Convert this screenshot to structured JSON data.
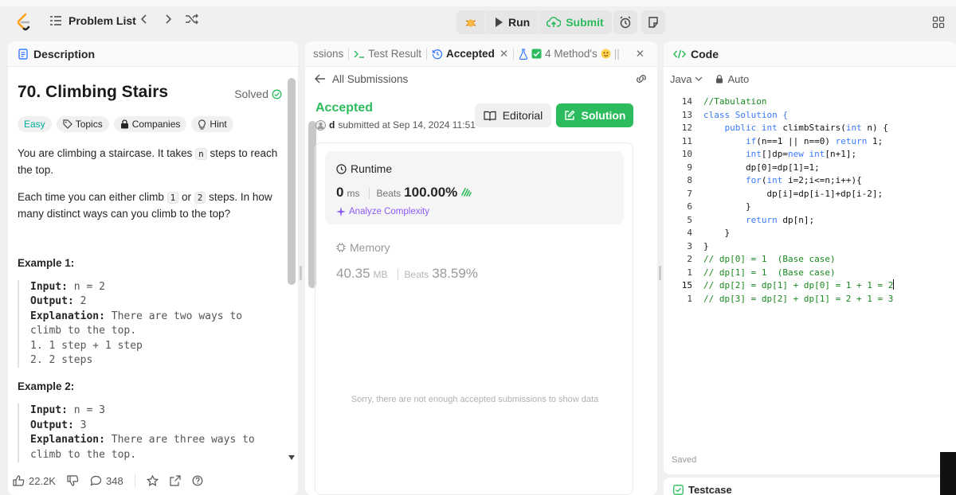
{
  "topbar": {
    "problem_list": "Problem List",
    "run": "Run",
    "submit": "Submit"
  },
  "colors": {
    "accent_green": "#2cbb5d",
    "easy": "#00af9b",
    "orange": "#ffa116",
    "purple": "#8b5cf6",
    "keyword_blue": "#3a7bff",
    "comment_green": "#18891e"
  },
  "description": {
    "tab_label": "Description",
    "title": "70. Climbing Stairs",
    "solved": "Solved",
    "tags": {
      "easy": "Easy",
      "topics": "Topics",
      "companies": "Companies",
      "hint": "Hint"
    },
    "para1": {
      "before": "You are climbing a staircase. It takes ",
      "code": "n",
      "after": " steps to reach the top."
    },
    "para2": {
      "a": "Each time you can either climb ",
      "c1": "1",
      "b": " or ",
      "c2": "2",
      "d": " steps. In how many distinct ways can you climb to the top?"
    },
    "examples": [
      {
        "title": "Example 1:",
        "input_label": "Input:",
        "input_value": " n = 2",
        "output_label": "Output:",
        "output_value": " 2",
        "explanation_label": "Explanation:",
        "explanation_value": " There are two ways to\nclimb to the top.\n1. 1 step + 1 step\n2. 2 steps"
      },
      {
        "title": "Example 2:",
        "input_label": "Input:",
        "input_value": " n = 3",
        "output_label": "Output:",
        "output_value": " 3",
        "explanation_label": "Explanation:",
        "explanation_value": " There are three ways to\nclimb to the top."
      }
    ],
    "footer": {
      "likes": "22.2K",
      "comments": "348"
    }
  },
  "middle": {
    "tabs": {
      "submissions": "ssions",
      "test_result": "Test Result",
      "accepted": "Accepted",
      "method": "4 Method's"
    },
    "all_submissions": "All Submissions",
    "status": "Accepted",
    "submitted_by": "d",
    "submitted_at": "submitted at Sep 14, 2024 11:51",
    "editorial": "Editorial",
    "solution": "Solution",
    "runtime": {
      "title": "Runtime",
      "value": "0",
      "unit": "ms",
      "beats_label": "Beats",
      "beats_value": "100.00%",
      "analyze": "Analyze Complexity"
    },
    "memory": {
      "title": "Memory",
      "value": "40.35",
      "unit": "MB",
      "beats_label": "Beats",
      "beats_value": "38.59%"
    },
    "no_data": "Sorry, there are not enough accepted submissions to show data"
  },
  "code_panel": {
    "tab_label": "Code",
    "language": "Java",
    "auto": "Auto",
    "saved": "Saved",
    "line_numbers": [
      "14",
      "13",
      "12",
      "11",
      "10",
      "9",
      "8",
      "7",
      "6",
      "5",
      "4",
      "3",
      "2",
      "1",
      "15",
      "1"
    ],
    "lines": [
      "//Tabulation",
      "class Solution {",
      "    public int climbStairs(int n) {",
      "        if(n==1 || n==0) return 1;",
      "        int[]dp=new int[n+1];",
      "        dp[0]=dp[1]=1;",
      "        for(int i=2;i<=n;i++){",
      "            dp[i]=dp[i-1]+dp[i-2];",
      "        }",
      "        return dp[n];",
      "    }",
      "}",
      "// dp[0] = 1  (Base case)",
      "// dp[1] = 1  (Base case)",
      "// dp[2] = dp[1] + dp[0] = 1 + 1 = 2",
      "// dp[3] = dp[2] + dp[1] = 2 + 1 = 3"
    ]
  },
  "testcase": {
    "label": "Testcase"
  }
}
